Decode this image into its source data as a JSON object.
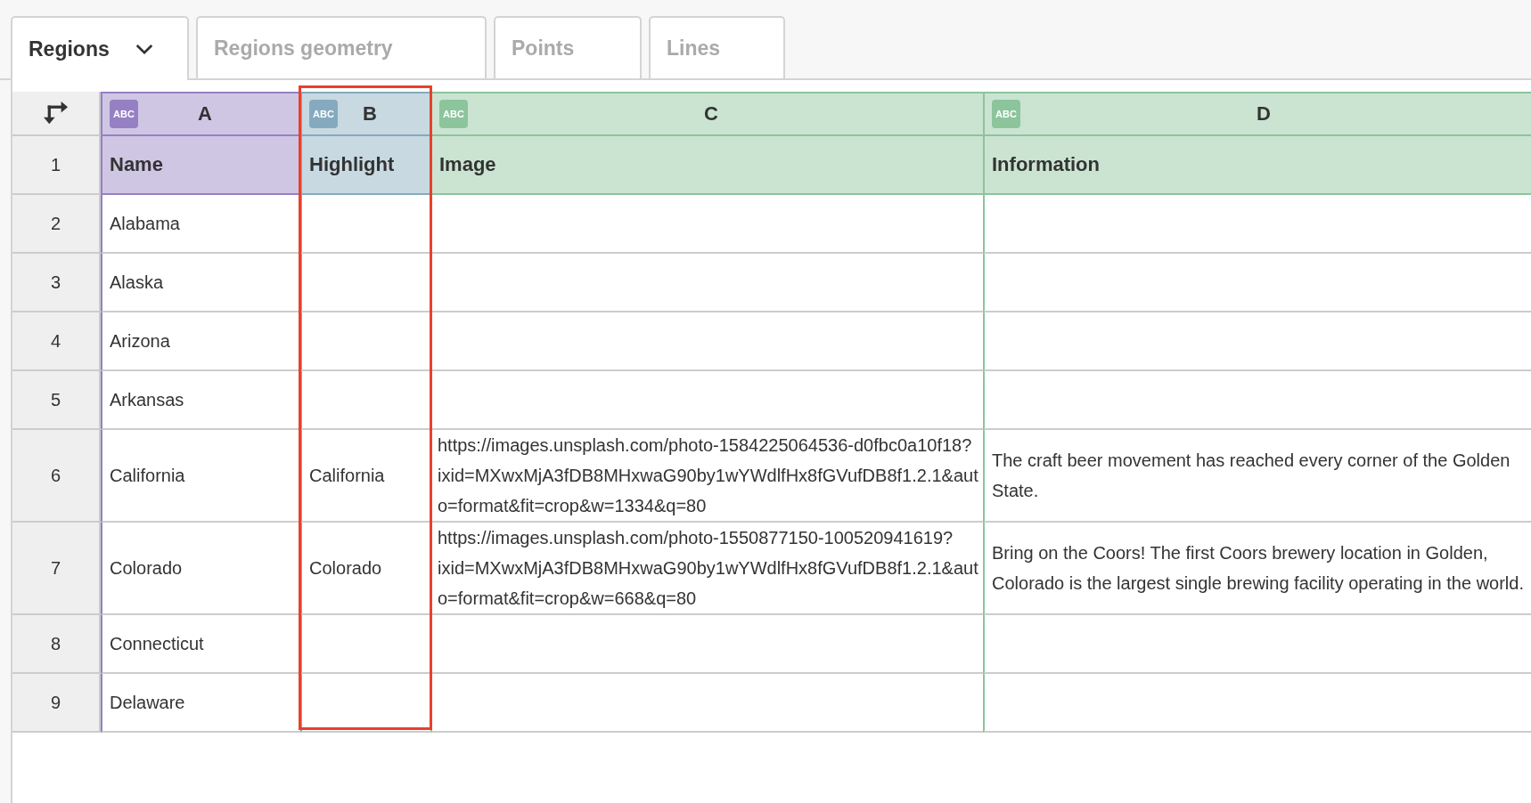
{
  "tabs": [
    {
      "label": "Regions",
      "selected": true
    },
    {
      "label": "Regions geometry",
      "selected": false
    },
    {
      "label": "Points",
      "selected": false
    },
    {
      "label": "Lines",
      "selected": false
    }
  ],
  "sheet": {
    "columns": [
      {
        "letter": "A",
        "badge": "ABC",
        "color": "#9580c4",
        "selected": false
      },
      {
        "letter": "B",
        "badge": "ABC",
        "color": "#85aabf",
        "selected": true
      },
      {
        "letter": "C",
        "badge": "ABC",
        "color": "#8cc49c",
        "selected": false
      },
      {
        "letter": "D",
        "badge": "ABC",
        "color": "#8cc49c",
        "selected": false
      }
    ],
    "header_row": {
      "number": "1",
      "cells": [
        "Name",
        "Highlight",
        "Image",
        "Information"
      ]
    },
    "rows": [
      {
        "number": "2",
        "name": "Alabama"
      },
      {
        "number": "3",
        "name": "Alaska"
      },
      {
        "number": "4",
        "name": "Arizona"
      },
      {
        "number": "5",
        "name": "Arkansas"
      },
      {
        "number": "6",
        "name": "California",
        "highlight": "California",
        "image": "https://images.unsplash.com/photo-1584225064536-d0fbc0a10f18?ixid=MXwxMjA3fDB8MHxwaG90by1wYWdlfHx8fGVufDB8f1.2.1&auto=format&fit=crop&w=1334&q=80",
        "information": "The craft beer movement has reached every corner of the Golden State."
      },
      {
        "number": "7",
        "name": "Colorado",
        "highlight": "Colorado",
        "image": "https://images.unsplash.com/photo-1550877150-100520941619?ixid=MXwxMjA3fDB8MHxwaG90by1wYWdlfHx8fGVufDB8f1.2.1&auto=format&fit=crop&w=668&q=80",
        "information": "Bring on the Coors! The first Coors brewery location in Golden, Colorado is the largest single brewing facility operating in the world."
      },
      {
        "number": "8",
        "name": "Connecticut"
      },
      {
        "number": "9",
        "name": "Delaware"
      }
    ]
  }
}
